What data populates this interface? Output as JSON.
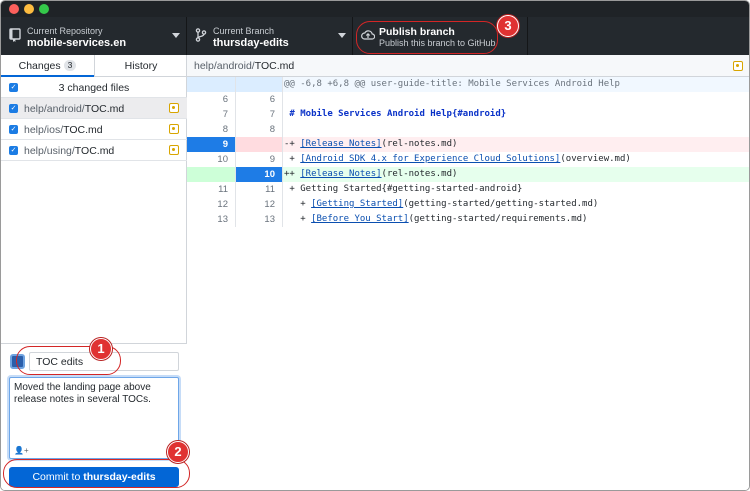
{
  "toolbar": {
    "repo_label": "Current Repository",
    "repo_name": "mobile-services.en",
    "branch_label": "Current Branch",
    "branch_name": "thursday-edits",
    "publish_title": "Publish branch",
    "publish_subtitle": "Publish this branch to GitHub"
  },
  "sidebar": {
    "tabs": [
      {
        "label": "Changes",
        "count": "3"
      },
      {
        "label": "History"
      }
    ],
    "changed_files_label": "3 changed files",
    "files": [
      {
        "dir": "help/android/",
        "name": "TOC.md"
      },
      {
        "dir": "help/ios/",
        "name": "TOC.md"
      },
      {
        "dir": "help/using/",
        "name": "TOC.md"
      }
    ]
  },
  "commit": {
    "summary": "TOC edits",
    "description": "Moved the landing page above release notes in several TOCs.",
    "button_prefix": "Commit to ",
    "button_branch": "thursday-edits"
  },
  "diff": {
    "file_dir": "help/android/",
    "file_name": "TOC.md",
    "rows": [
      {
        "old": "",
        "new": "",
        "text": "@@ -6,8 +6,8 @@ user-guide-title: Mobile Services Android Help"
      },
      {
        "old": "6",
        "new": "6",
        "text": ""
      },
      {
        "old": "7",
        "new": "7",
        "text": " # Mobile Services Android Help{#android}"
      },
      {
        "old": "8",
        "new": "8",
        "text": ""
      },
      {
        "old": "9",
        "new": "",
        "prefix": "-+ ",
        "link": "[Release Notes]",
        "rest": "(rel-notes.md)"
      },
      {
        "old": "10",
        "new": "9",
        "prefix": " + ",
        "link": "[Android SDK 4.x for Experience Cloud Solutions]",
        "rest": "(overview.md)"
      },
      {
        "old": "",
        "new": "10",
        "prefix": "++ ",
        "link": "[Release Notes]",
        "rest": "(rel-notes.md)"
      },
      {
        "old": "11",
        "new": "11",
        "text": " + Getting Started{#getting-started-android}"
      },
      {
        "old": "12",
        "new": "12",
        "prefix": "   + ",
        "link": "[Getting Started]",
        "rest": "(getting-started/getting-started.md)"
      },
      {
        "old": "13",
        "new": "13",
        "prefix": "   + ",
        "link": "[Before You Start]",
        "rest": "(getting-started/requirements.md)"
      }
    ]
  },
  "callouts": [
    "1",
    "2",
    "3"
  ],
  "colors": {
    "accent": "#0366d6",
    "callout": "#e03232",
    "toolbar": "#24292e"
  }
}
